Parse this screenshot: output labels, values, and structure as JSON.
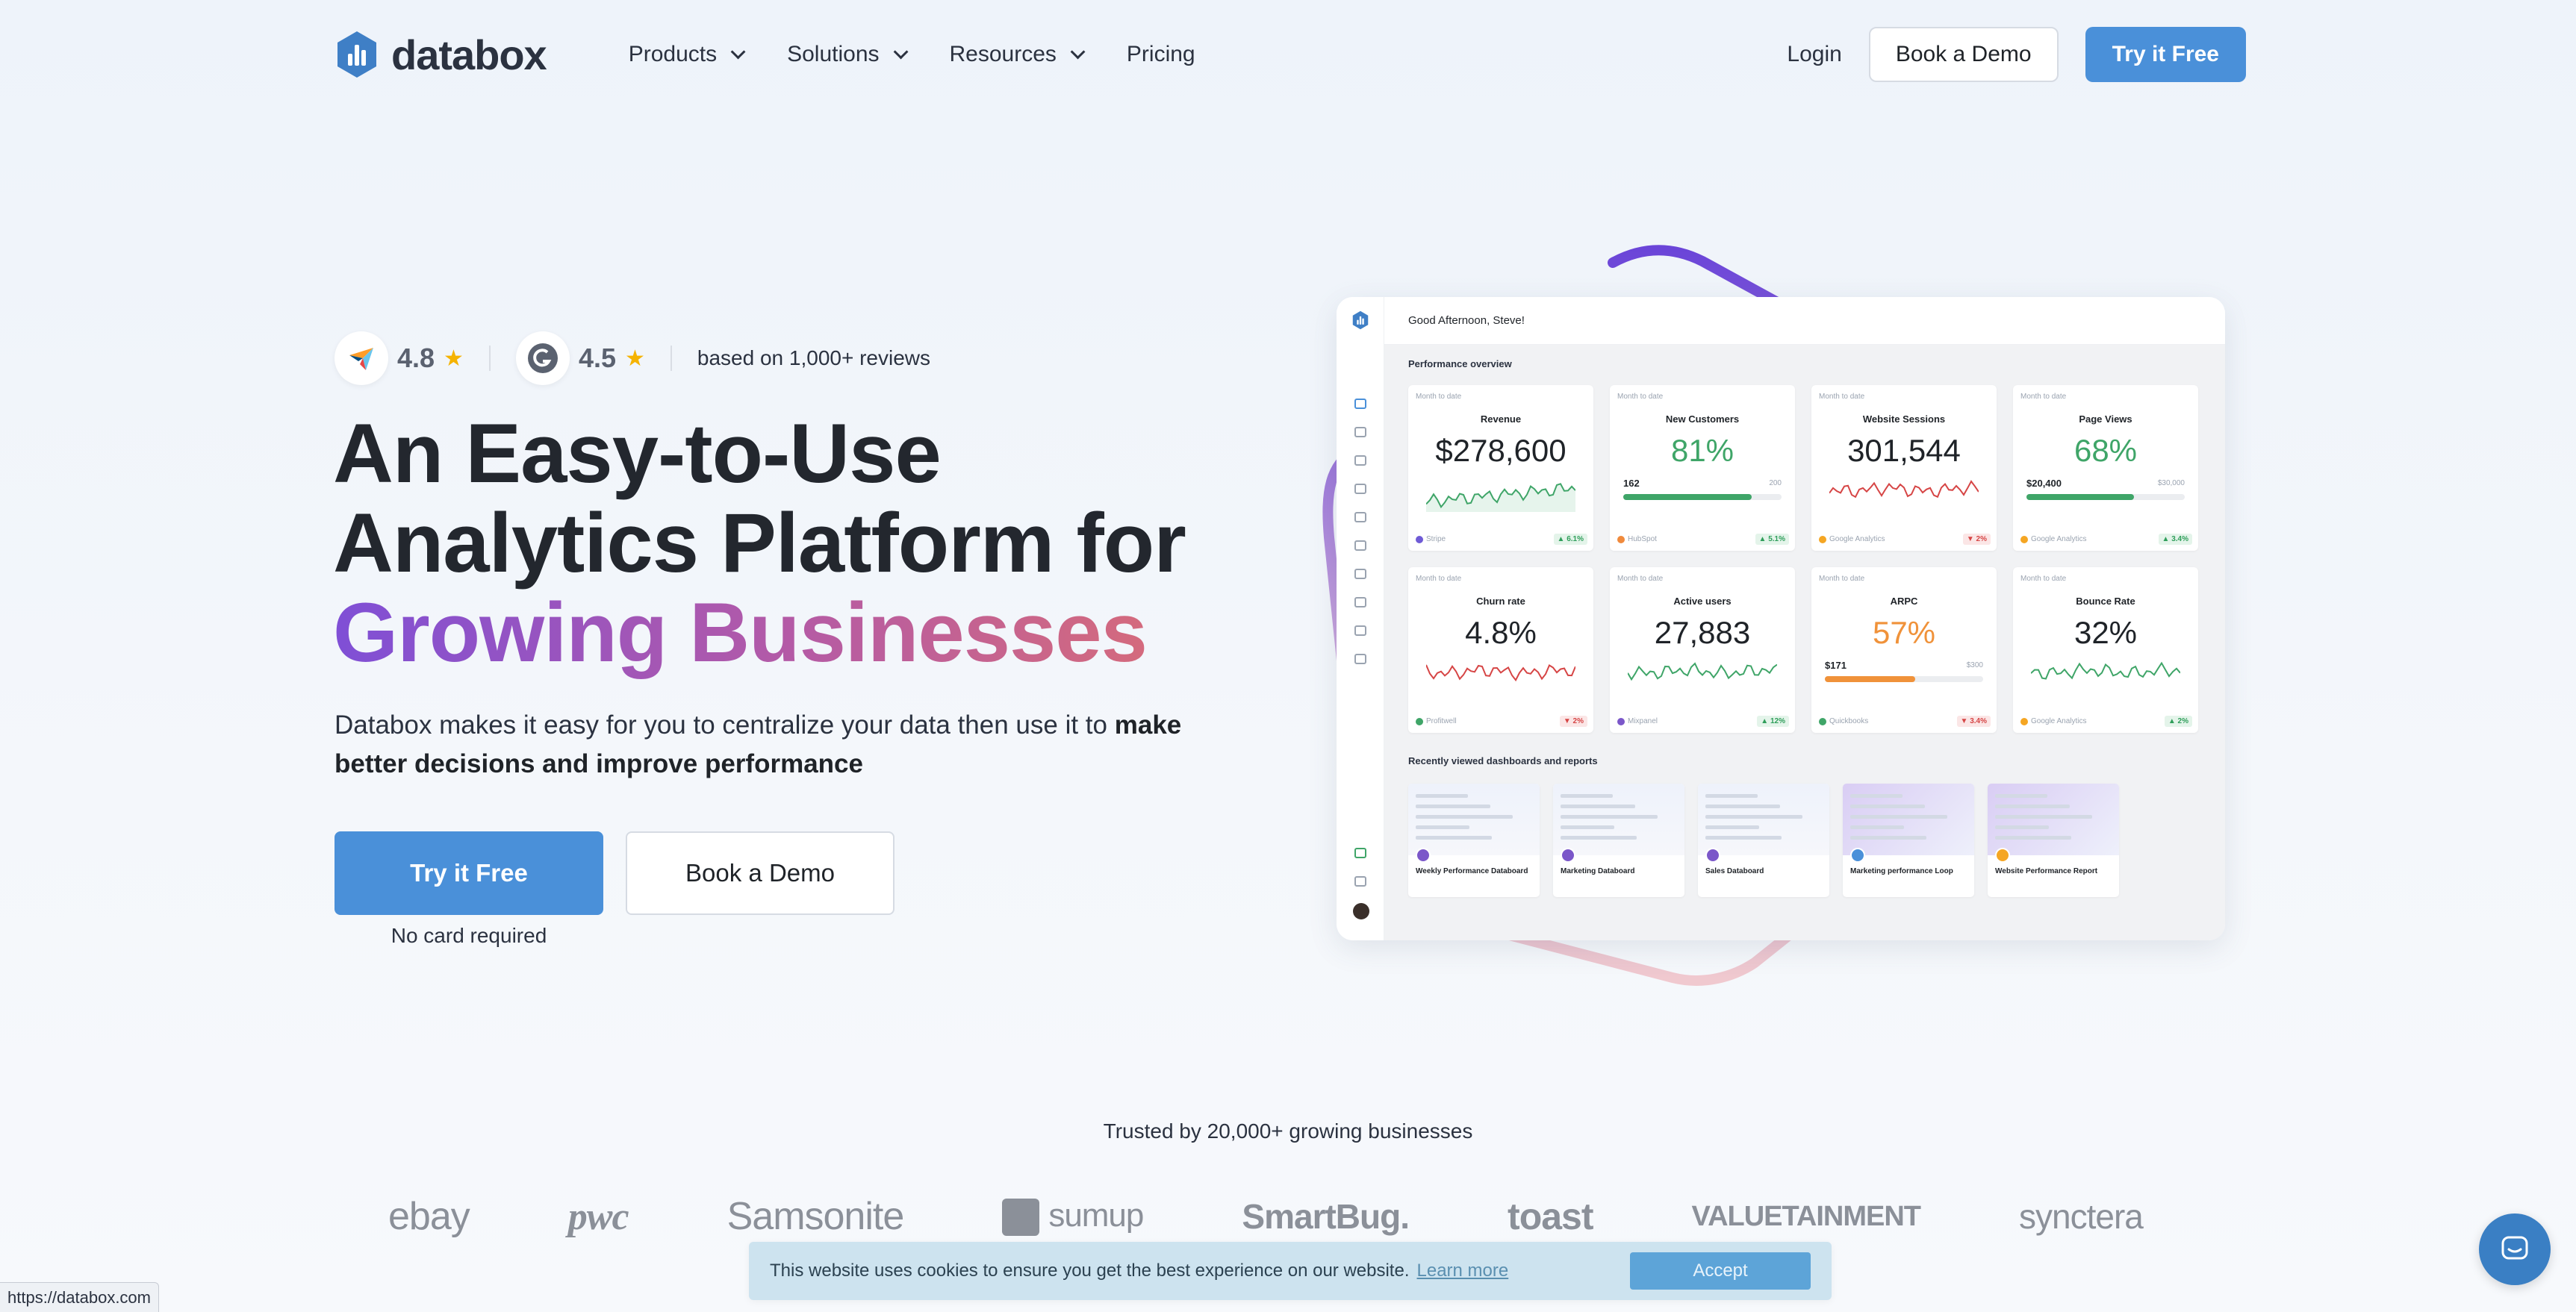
{
  "header": {
    "logo_text": "databox",
    "nav": [
      {
        "label": "Products"
      },
      {
        "label": "Solutions"
      },
      {
        "label": "Resources"
      },
      {
        "label": "Pricing"
      }
    ],
    "login": "Login",
    "book_demo": "Book a Demo",
    "try_free": "Try it Free"
  },
  "ratings": {
    "capterra": "4.8",
    "g2": "4.5",
    "reviews_text": "based on 1,000+ reviews"
  },
  "hero": {
    "title_line1": "An Easy-to-Use",
    "title_line2": "Analytics Platform for",
    "title_line3": "Growing Businesses",
    "desc_plain": "Databox makes it easy for you to centralize your data then use it to ",
    "desc_bold": "make better decisions and improve performance",
    "cta_primary": "Try it Free",
    "cta_secondary": "Book a Demo",
    "no_card": "No card required"
  },
  "dashboard": {
    "greeting": "Good Afternoon, Steve!",
    "perf_title": "Performance overview",
    "month_label": "Month to date",
    "cards": [
      {
        "title": "Revenue",
        "value": "$278,600",
        "source": "Stripe",
        "change": "▲ 6.1%",
        "dir": "up",
        "spark": "green",
        "color": "#6f5bd6"
      },
      {
        "title": "New Customers",
        "value": "81%",
        "bar_left": "162",
        "bar_right": "200",
        "fill": 0.81,
        "fill_color": "#3fa568",
        "source": "HubSpot",
        "change": "▲ 5.1%",
        "dir": "up",
        "color": "#f08a3c"
      },
      {
        "title": "Website Sessions",
        "value": "301,544",
        "source": "Google Analytics",
        "change": "▼ 2%",
        "dir": "down",
        "spark": "red",
        "color": "#f5a623"
      },
      {
        "title": "Page Views",
        "value": "68%",
        "bar_left": "$20,400",
        "bar_right": "$30,000",
        "fill": 0.68,
        "fill_color": "#3fa568",
        "source": "Google Analytics",
        "change": "▲ 3.4%",
        "dir": "up",
        "color": "#f5a623"
      },
      {
        "title": "Churn rate",
        "value": "4.8%",
        "source": "Profitwell",
        "change": "▼ 2%",
        "dir": "down",
        "spark": "red",
        "color": "#3fa568"
      },
      {
        "title": "Active users",
        "value": "27,883",
        "source": "Mixpanel",
        "change": "▲ 12%",
        "dir": "up",
        "spark": "green",
        "color": "#7b57c9"
      },
      {
        "title": "ARPC",
        "value": "57%",
        "bar_left": "$171",
        "bar_right": "$300",
        "fill": 0.57,
        "fill_color": "#f0923a",
        "source": "Quickbooks",
        "change": "▼ 3.4%",
        "dir": "down",
        "color": "#3fa568"
      },
      {
        "title": "Bounce Rate",
        "value": "32%",
        "source": "Google Analytics",
        "change": "▲ 2%",
        "dir": "up",
        "spark": "green",
        "color": "#f5a623"
      }
    ],
    "recent_title": "Recently viewed dashboards and reports",
    "recent": [
      {
        "label": "Weekly Performance Databoard"
      },
      {
        "label": "Marketing Databoard"
      },
      {
        "label": "Sales Databoard"
      },
      {
        "label": "Marketing performance Loop"
      },
      {
        "label": "Website Performance Report"
      }
    ]
  },
  "trusted": {
    "text": "Trusted by 20,000+ growing businesses",
    "logos": [
      "ebay",
      "pwc",
      "Samsonite",
      "sumup",
      "SmartBug.",
      "toast",
      "VALUETAINMENT",
      "synctera"
    ]
  },
  "cookie": {
    "text": "This website uses cookies to ensure you get the best experience on our website.",
    "link": "Learn more",
    "accept": "Accept"
  },
  "status_url": "https://databox.com",
  "colors": {
    "primary": "#4a90d9",
    "text": "#23272e",
    "gradient_start": "#7f4fd6",
    "gradient_end": "#d46a7d"
  }
}
